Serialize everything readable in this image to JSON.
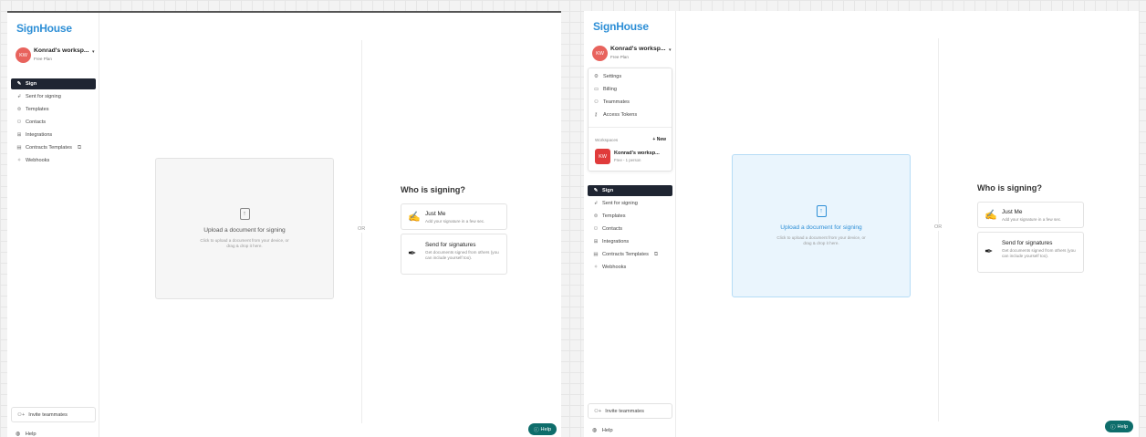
{
  "brand": {
    "name": "SignHouse"
  },
  "workspace": {
    "initials": "KW",
    "name": "Konrad's worksp...",
    "plan": "Free Plan"
  },
  "nav": {
    "items": [
      {
        "label": "Sign",
        "icon": "pen-icon"
      },
      {
        "label": "Sent for signing",
        "icon": "send-icon"
      },
      {
        "label": "Templates",
        "icon": "template-icon"
      },
      {
        "label": "Contacts",
        "icon": "contacts-icon"
      },
      {
        "label": "Integrations",
        "icon": "grid-icon"
      },
      {
        "label": "Contracts Templates",
        "icon": "document-icon"
      },
      {
        "label": "Webhooks",
        "icon": "webhook-icon"
      }
    ]
  },
  "menu": {
    "items": [
      {
        "label": "Settings",
        "icon": "gear-icon"
      },
      {
        "label": "Billing",
        "icon": "card-icon"
      },
      {
        "label": "Teammates",
        "icon": "team-icon"
      },
      {
        "label": "Access Tokens",
        "icon": "key-icon"
      }
    ],
    "workspaces_label": "Workspaces",
    "new_label": "New",
    "workspace_initials": "KW",
    "workspace_name": "Konrad's worksp...",
    "workspace_sub": "Free - 1 person"
  },
  "footer": {
    "invite_label": "Invite teammates",
    "help_label": "Help"
  },
  "upload": {
    "title": "Upload a document for signing",
    "subtitle": "Click to upload a document from your device, or drag & drop it here."
  },
  "or_label": "OR",
  "signing": {
    "title": "Who is signing?",
    "options": [
      {
        "title": "Just Me",
        "description": "Add your signature in a few sec."
      },
      {
        "title": "Send for signatures",
        "description": "Get documents signed from others (you can include yourself too)."
      }
    ]
  },
  "help_button": {
    "label": "Help"
  },
  "colors": {
    "brand": "#2e8fd6",
    "active_nav": "#1f2532",
    "help_button": "#0e6d6b",
    "avatar": "#e8635d"
  }
}
